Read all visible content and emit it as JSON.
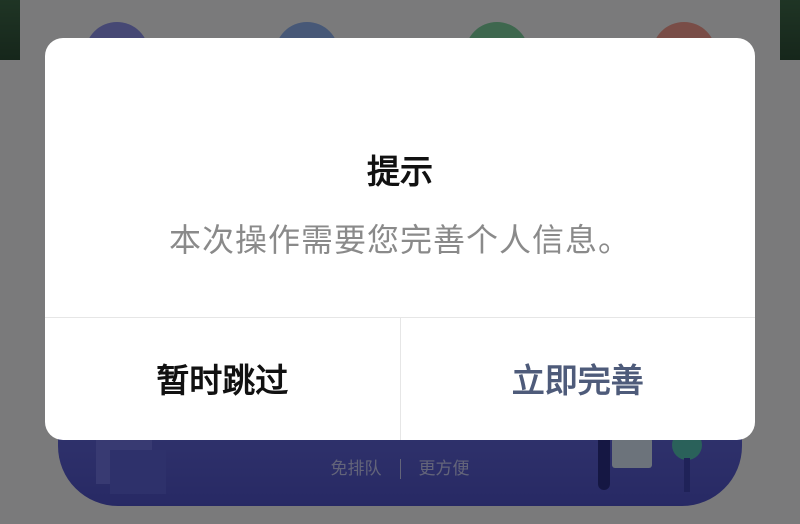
{
  "background": {
    "banner_text_left": "免排队",
    "banner_text_right": "更方便"
  },
  "dialog": {
    "title": "提示",
    "message": "本次操作需要您完善个人信息。",
    "buttons": {
      "skip_label": "暂时跳过",
      "complete_label": "立即完善"
    }
  },
  "colors": {
    "overlay": "#000000",
    "dialog_bg": "#ffffff",
    "primary_button_text": "#4e5b7a",
    "secondary_button_text": "#111111",
    "message_text": "#8a8a8a"
  }
}
